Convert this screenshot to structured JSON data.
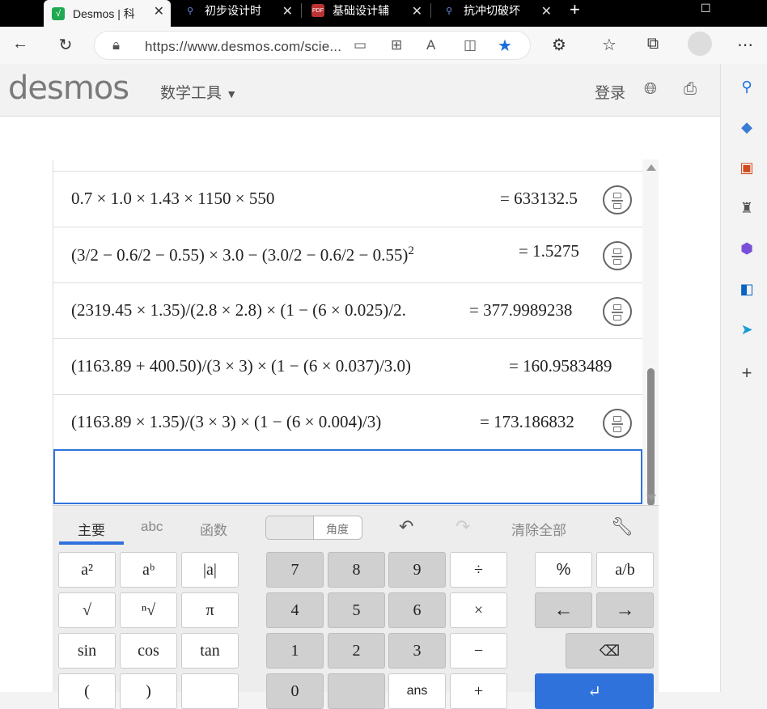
{
  "browser": {
    "tabs": [
      {
        "title": "Desmos | 科",
        "active": true
      },
      {
        "title": "初步设计时"
      },
      {
        "title": "基础设计辅"
      },
      {
        "title": "抗冲切破坏"
      }
    ],
    "new_tab": "+",
    "url": "https://www.desmos.com/scie..."
  },
  "desmos": {
    "logo": "desmos",
    "tools_menu": "数学工具",
    "login": "登录"
  },
  "expressions": [
    {
      "formula": "0.7 × 1.0 × 1.43 × 1150 × 550",
      "result": "= 633132.5",
      "has_toggle": true
    },
    {
      "formula": "(3/2 − 0.6/2 − 0.55) × 3.0 − (3.0/2 − 0.6/2 − 0.55)",
      "sup": "2",
      "result": "= 1.5275",
      "has_toggle": true
    },
    {
      "formula": "(2319.45 × 1.35)/(2.8 × 2.8) × (1 − (6 × 0.025)/2.",
      "result": "= 377.9989238",
      "has_toggle": true
    },
    {
      "formula": "(1163.89 + 400.50)/(3 × 3) × (1 − (6 × 0.037)/3.0)",
      "result": "= 160.9583489",
      "has_toggle": false
    },
    {
      "formula": "(1163.89 × 1.35)/(3 × 3) × (1 − (6 × 0.004)/3)",
      "result": "= 173.186832",
      "has_toggle": true
    }
  ],
  "keypad": {
    "tabs": [
      "主要",
      "abc",
      "函数"
    ],
    "angle_label": "角度",
    "clear_all": "清除全部",
    "keys": {
      "a_sq": "a²",
      "a_b": "aᵇ",
      "abs": "|a|",
      "sqrt": "√",
      "nroot": "ⁿ√",
      "pi": "π",
      "sin": "sin",
      "cos": "cos",
      "tan": "tan",
      "paren_l": "(",
      "paren_r": ")",
      "n7": "7",
      "n8": "8",
      "n9": "9",
      "div": "÷",
      "n4": "4",
      "n5": "5",
      "n6": "6",
      "mul": "×",
      "n1": "1",
      "n2": "2",
      "n3": "3",
      "minus": "−",
      "n0": "0",
      "ans": "ans",
      "plus": "+",
      "percent": "%",
      "frac": "a/b",
      "left": "←",
      "right": "→"
    }
  }
}
